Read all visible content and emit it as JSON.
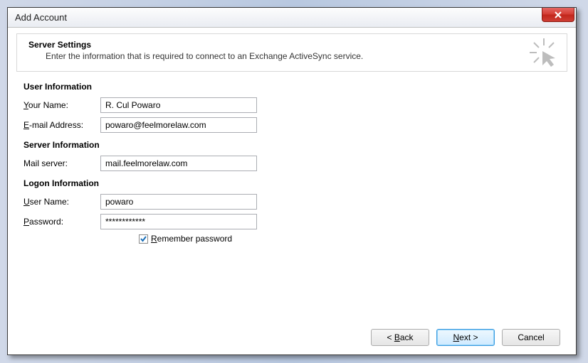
{
  "window": {
    "title": "Add Account"
  },
  "header": {
    "title": "Server Settings",
    "subtitle": "Enter the information that is required to connect to an Exchange ActiveSync service."
  },
  "sections": {
    "user": {
      "title": "User Information",
      "your_name_label_pre": "Y",
      "your_name_label_post": "our Name:",
      "your_name_value": "R. Cul Powaro",
      "email_label_pre": "E",
      "email_label_post": "-mail Address:",
      "email_value": "powaro@feelmorelaw.com"
    },
    "server": {
      "title": "Server Information",
      "mail_server_label": "Mail server:",
      "mail_server_value": "mail.feelmorelaw.com"
    },
    "logon": {
      "title": "Logon Information",
      "user_label_pre": "U",
      "user_label_post": "ser Name:",
      "user_value": "powaro",
      "password_label_pre": "P",
      "password_label_post": "assword:",
      "password_value": "************",
      "remember_pre": "R",
      "remember_post": "emember password",
      "remember_checked": true
    }
  },
  "buttons": {
    "back_pre": "< ",
    "back_u": "B",
    "back_post": "ack",
    "next_u": "N",
    "next_post": "ext >",
    "cancel": "Cancel"
  }
}
